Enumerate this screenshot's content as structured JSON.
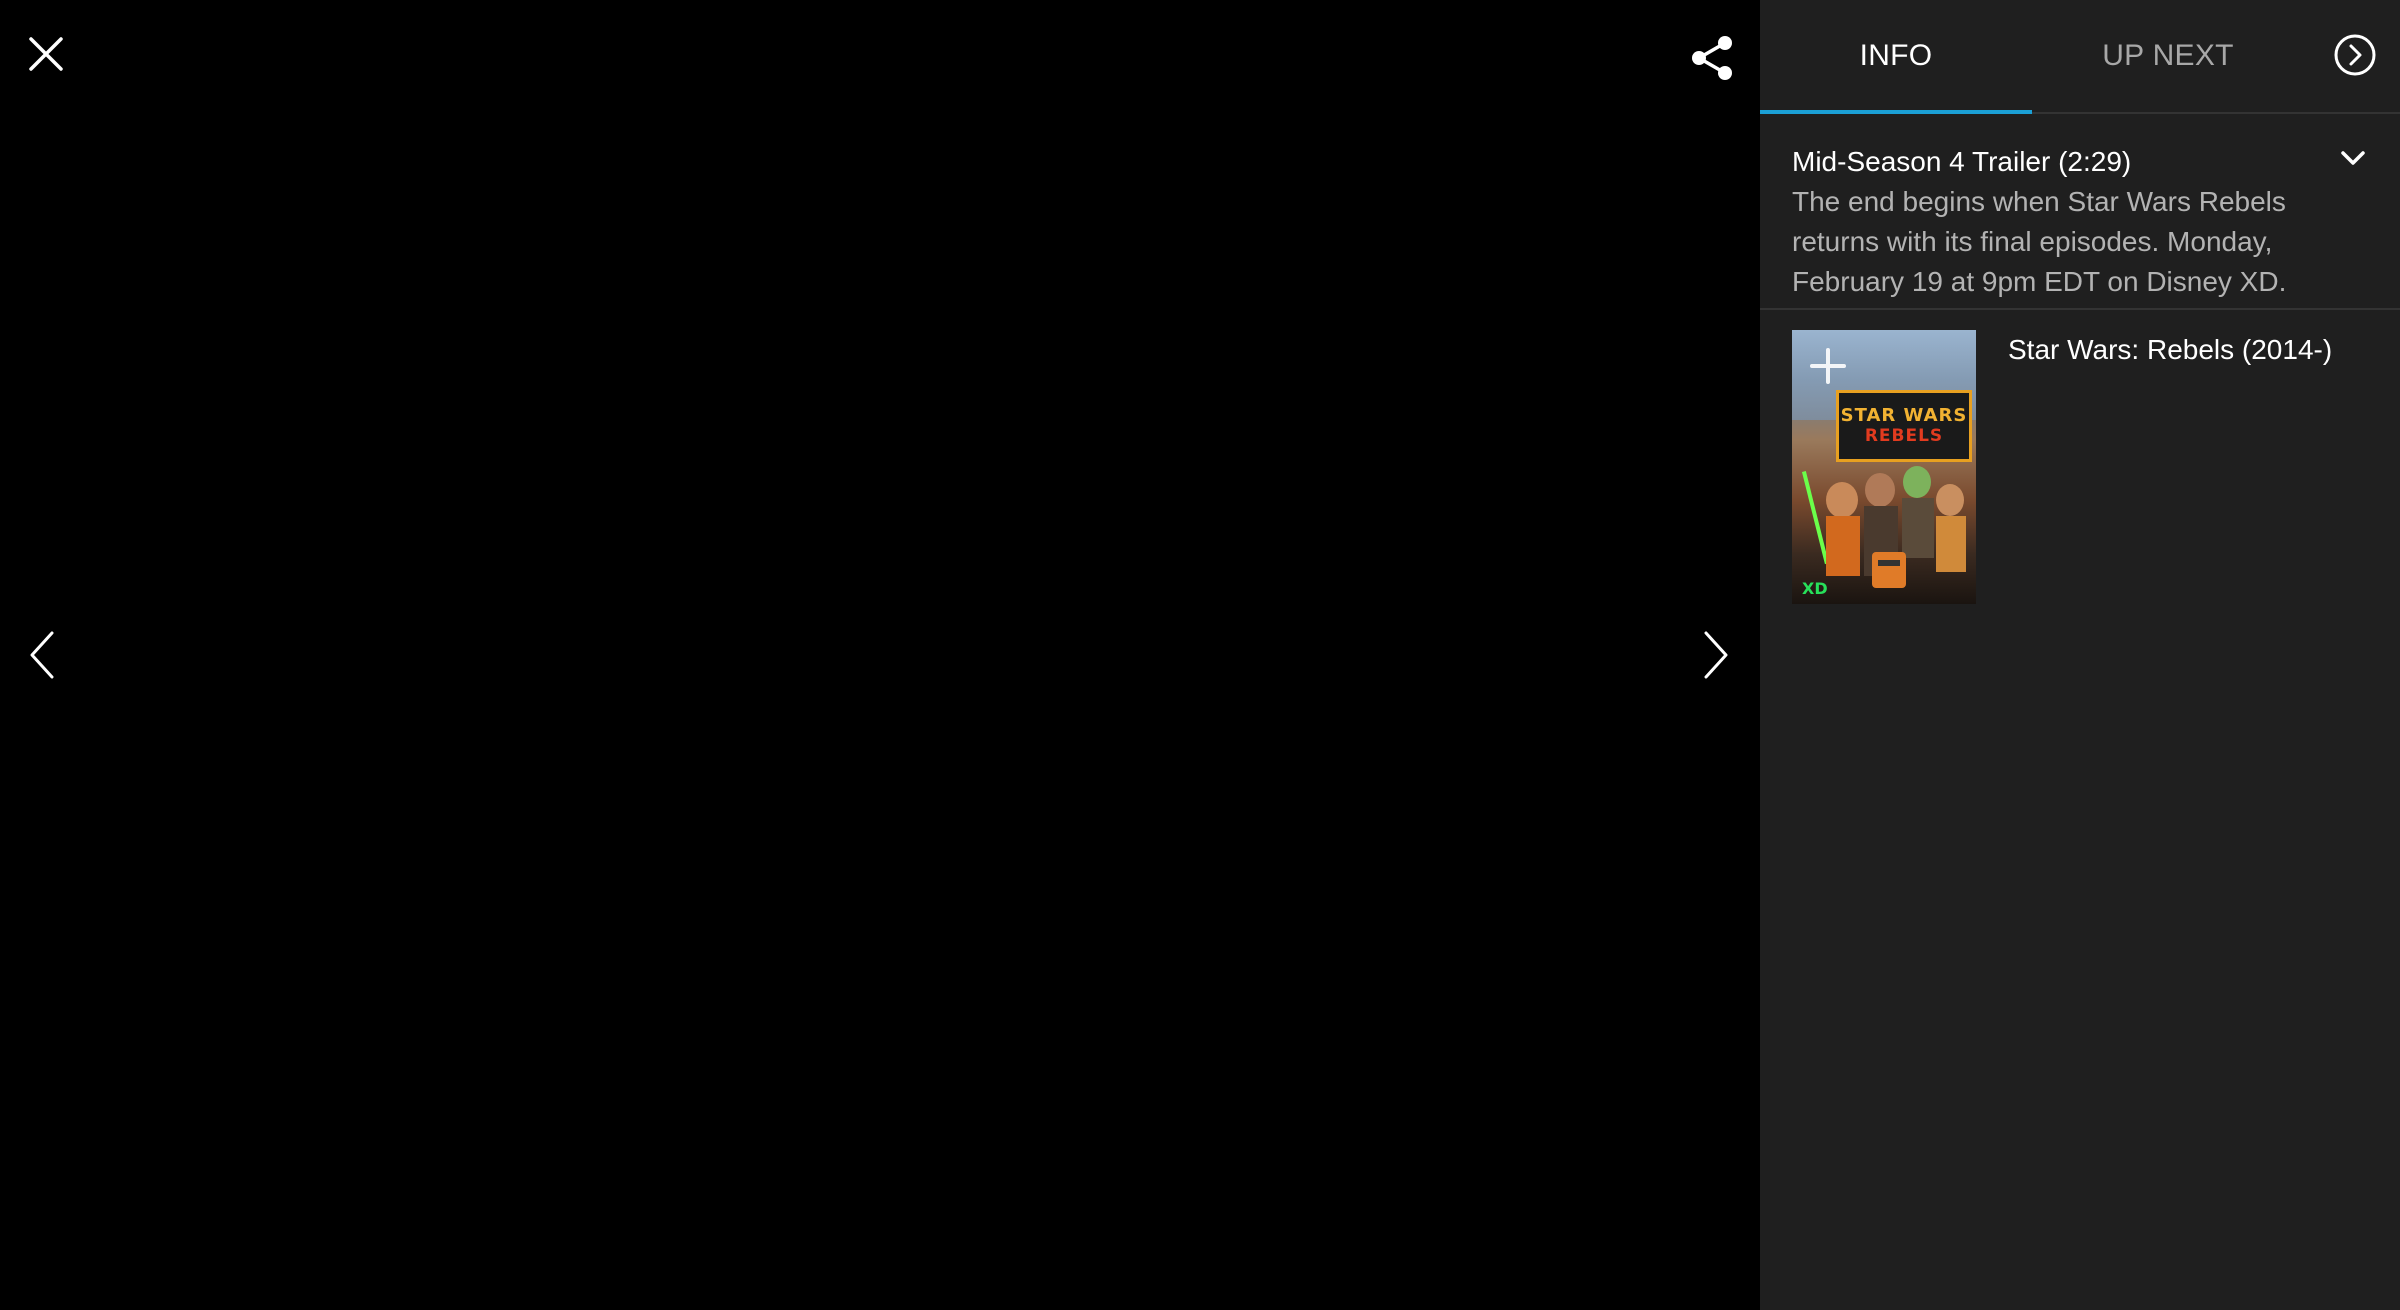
{
  "viewer": {
    "close_icon": "close-icon",
    "share_icon": "share-icon",
    "prev_icon": "chevron-left-icon",
    "next_icon": "chevron-right-icon"
  },
  "sidebar": {
    "tabs": [
      {
        "label": "INFO",
        "active": true
      },
      {
        "label": "UP NEXT",
        "active": false
      }
    ],
    "accent_color": "#1ba0d6",
    "video": {
      "title": "Mid-Season 4 Trailer (2:29)",
      "description": "The end begins when Star Wars Rebels returns with its final episodes. Monday, February 19 at 9pm EDT on Disney XD."
    },
    "related": {
      "show_title": "Star Wars: Rebels (2014-)",
      "poster_logo_line1": "STAR WARS",
      "poster_logo_line2": "REBELS",
      "poster_badge": "XD"
    }
  }
}
